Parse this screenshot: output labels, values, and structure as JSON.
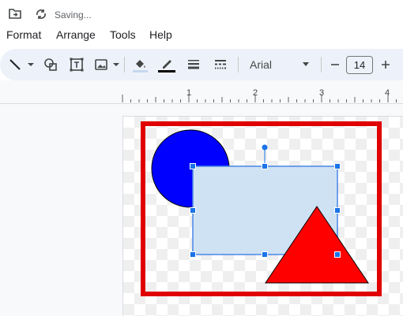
{
  "status": {
    "saving_text": "Saving..."
  },
  "menu": [
    {
      "label": "Format"
    },
    {
      "label": "Arrange"
    },
    {
      "label": "Tools"
    },
    {
      "label": "Help"
    }
  ],
  "toolbar": {
    "font_name": "Arial",
    "font_size": "14",
    "minus_label": "−",
    "plus_label": "+",
    "fill_color": "#c7d7f0",
    "border_color": "#000000"
  },
  "ruler": {
    "labels": [
      "1",
      "2",
      "3",
      "4"
    ]
  },
  "canvas": {
    "shapes": [
      {
        "kind": "frame",
        "stroke": "#e00000"
      },
      {
        "kind": "circle",
        "fill": "#0000ff"
      },
      {
        "kind": "rectangle",
        "fill": "#cfe2f3",
        "stroke": "#4a86e8",
        "selected": true
      },
      {
        "kind": "triangle",
        "fill": "#ff0000"
      }
    ]
  }
}
